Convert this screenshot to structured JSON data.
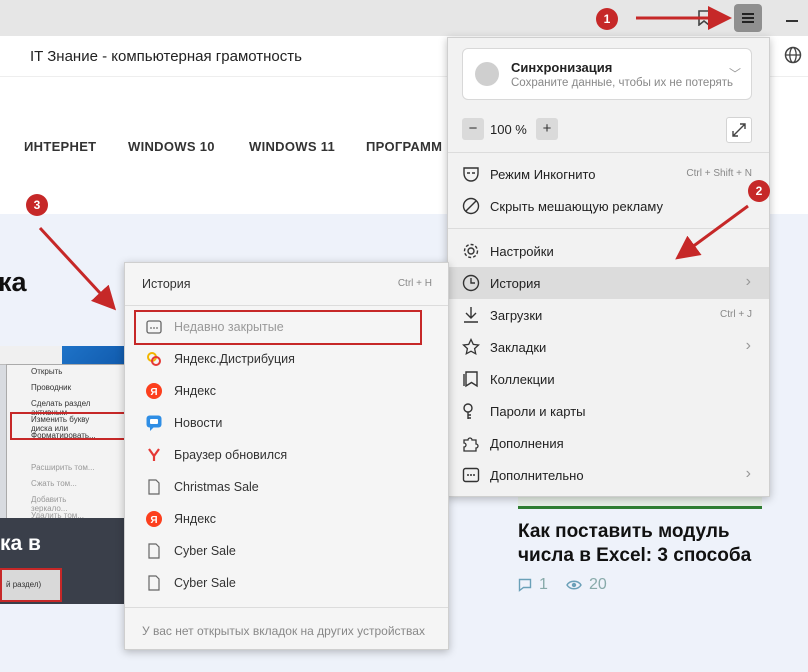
{
  "page": {
    "site_title": "IT Знание - компьютерная грамотность",
    "nav": [
      "ИНТЕРНЕТ",
      "WINDOWS 10",
      "WINDOWS 11",
      "ПРОГРАММ"
    ],
    "hero_heading": "ка",
    "thumbnail": {
      "menu_items": [
        "Открыть",
        "Проводник",
        "Сделать раздел активным",
        "Изменить букву диска или",
        "Форматировать...",
        "",
        "Расширить том...",
        "Сжать том...",
        "Добавить зеркало...",
        "Удалить том..."
      ],
      "overlay_text": "ка в",
      "dialog_text": "й раздел)"
    },
    "card": {
      "title": "Как поставить модуль числа в Excel: 3 способа",
      "comments": "1",
      "views": "20"
    }
  },
  "browser_menu": {
    "sync": {
      "title": "Синхронизация",
      "subtitle": "Сохраните данные, чтобы их не потерять"
    },
    "zoom": {
      "minus": "−",
      "value": "100 %",
      "plus": "+"
    },
    "items": [
      {
        "label": "Режим Инкогнито",
        "shortcut": "Ctrl + Shift + N",
        "icon": "incognito-mask-icon"
      },
      {
        "label": "Скрыть мешающую рекламу",
        "shortcut": "",
        "icon": "block-ads-icon"
      },
      {
        "label": "Настройки",
        "shortcut": "",
        "icon": "gear-icon"
      },
      {
        "label": "История",
        "shortcut": "",
        "icon": "clock-icon",
        "submenu": true,
        "active": true
      },
      {
        "label": "Загрузки",
        "shortcut": "Ctrl + J",
        "icon": "download-icon"
      },
      {
        "label": "Закладки",
        "shortcut": "",
        "icon": "star-icon",
        "submenu": true
      },
      {
        "label": "Коллекции",
        "shortcut": "",
        "icon": "collections-icon"
      },
      {
        "label": "Пароли и карты",
        "shortcut": "",
        "icon": "key-icon"
      },
      {
        "label": "Дополнения",
        "shortcut": "",
        "icon": "puzzle-icon"
      },
      {
        "label": "Дополнительно",
        "shortcut": "",
        "icon": "more-icon",
        "submenu": true
      }
    ]
  },
  "history_menu": {
    "header": "История",
    "header_shortcut": "Ctrl + H",
    "items": [
      {
        "label": "Недавно закрытые",
        "icon": "recent-tabs-icon",
        "muted": true
      },
      {
        "label": "Яндекс.Дистрибуция",
        "icon": "yandex-distribution-icon"
      },
      {
        "label": "Яндекс",
        "icon": "yandex-icon"
      },
      {
        "label": "Новости",
        "icon": "news-icon"
      },
      {
        "label": "Браузер обновился",
        "icon": "yandex-browser-icon"
      },
      {
        "label": "Christmas Sale",
        "icon": "page-icon"
      },
      {
        "label": "Яндекс",
        "icon": "yandex-icon"
      },
      {
        "label": "Cyber Sale",
        "icon": "page-icon"
      },
      {
        "label": "Cyber Sale",
        "icon": "page-icon"
      }
    ],
    "footer": "У вас нет открытых вкладок на других устройствах"
  },
  "annotations": [
    "1",
    "2",
    "3"
  ],
  "colors": {
    "annotation_red": "#c62828",
    "menu_bg": "#f2f2f2",
    "hero_bg": "#eef2fa"
  }
}
